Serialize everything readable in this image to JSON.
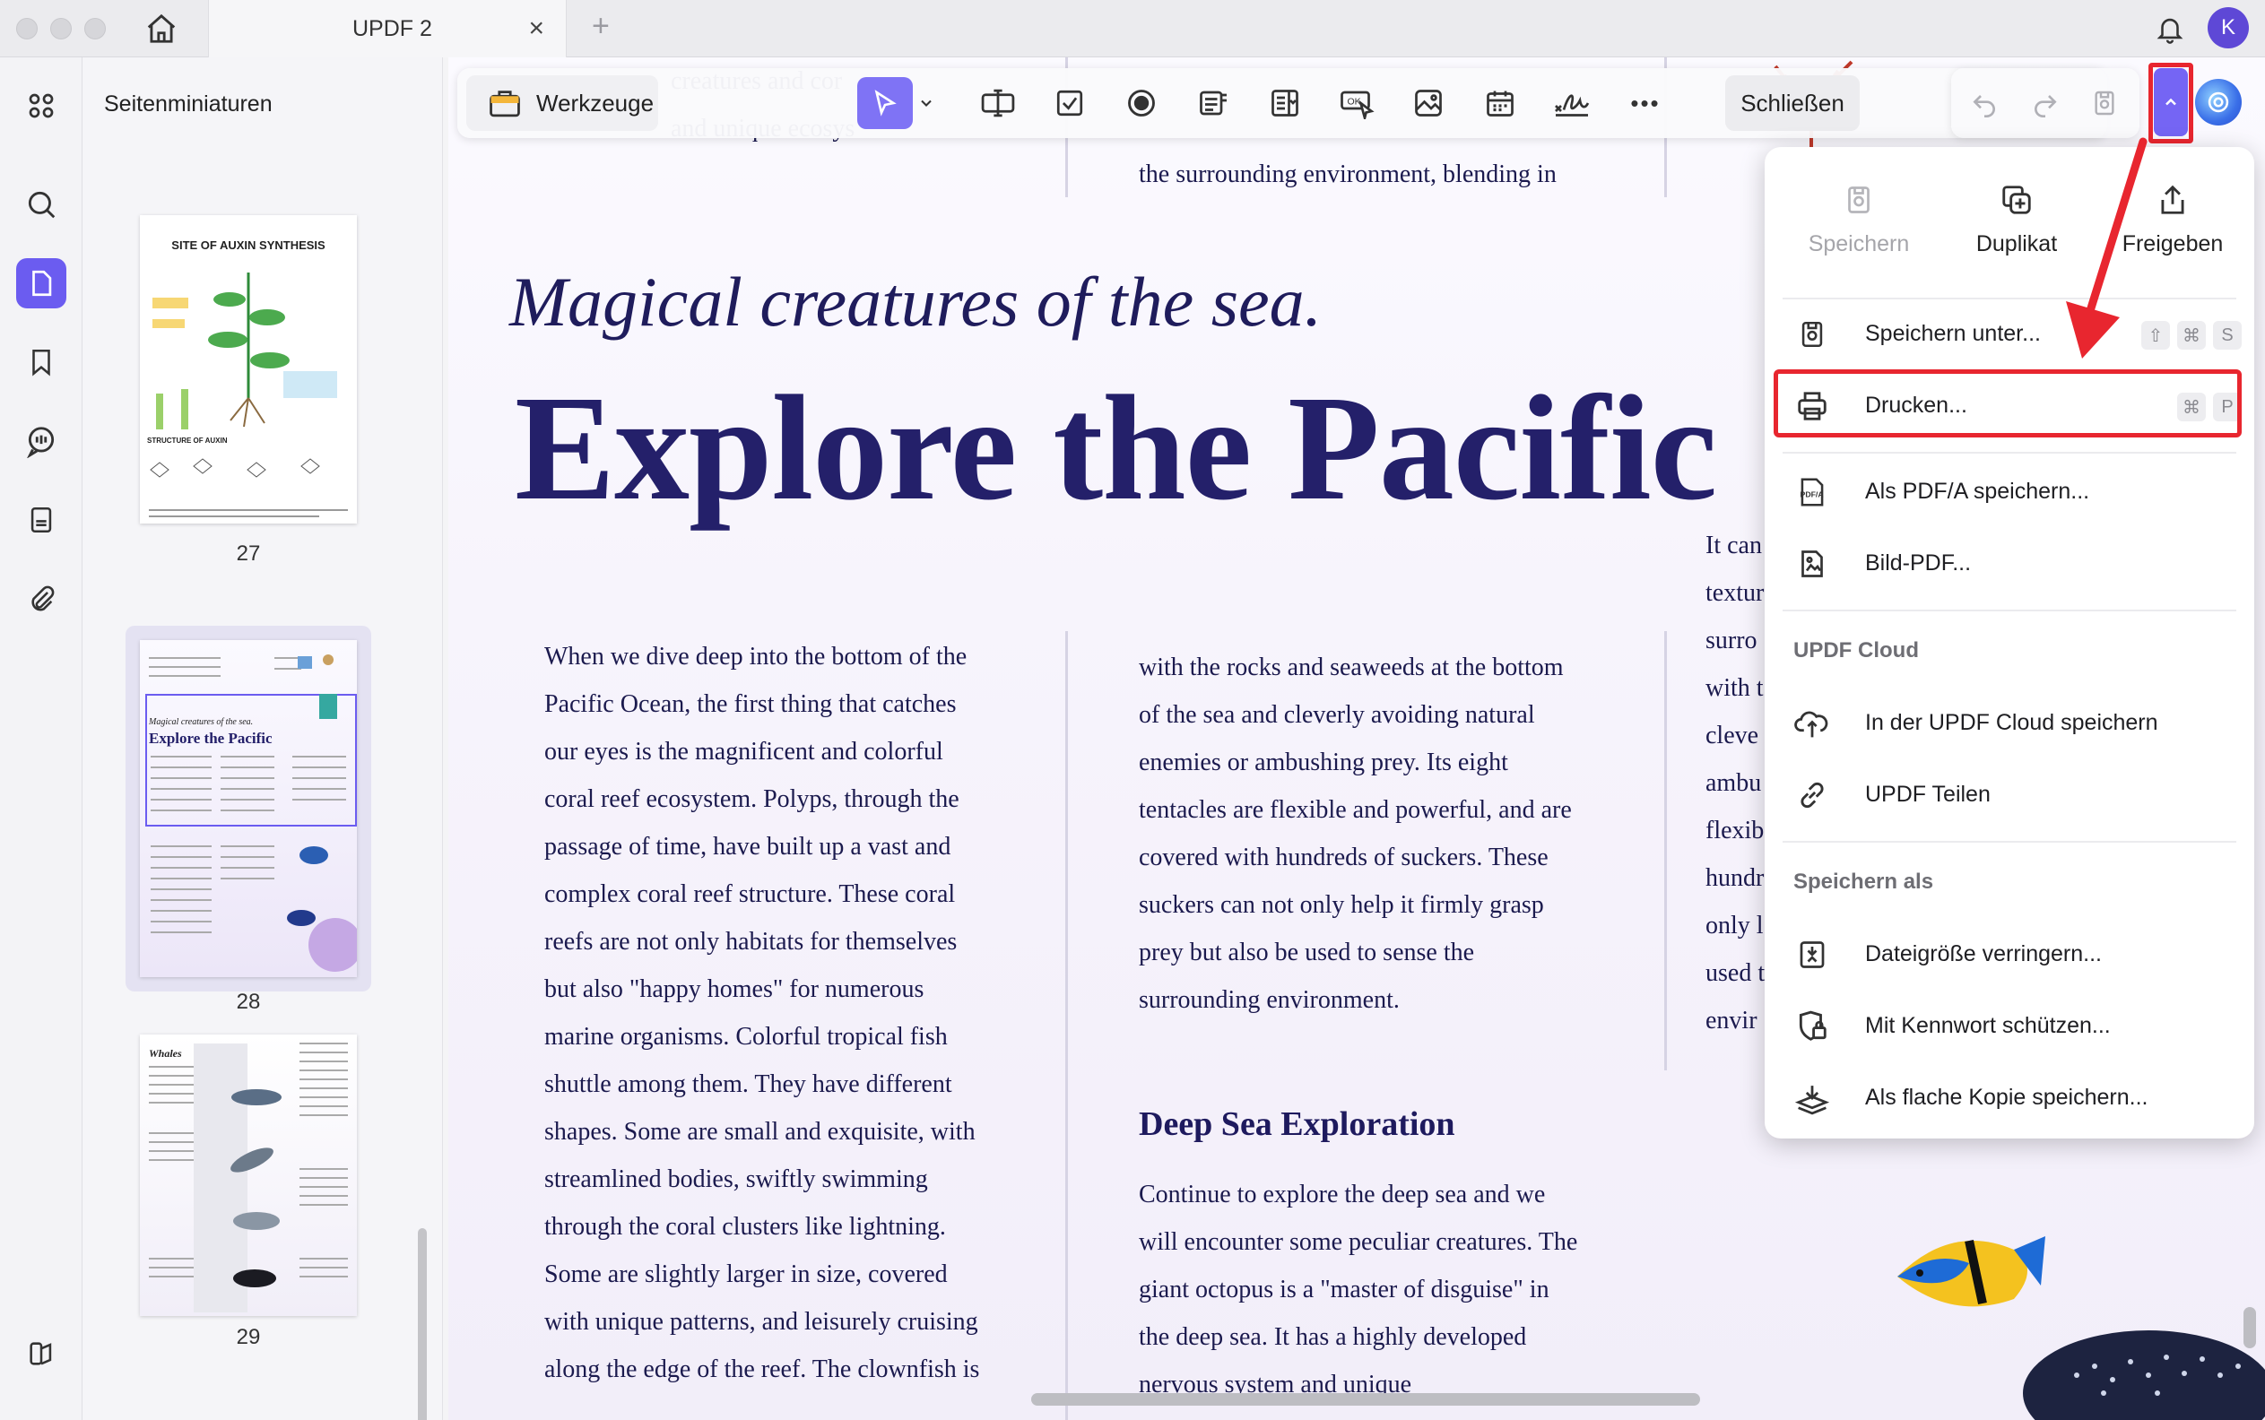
{
  "window": {
    "tab_title": "UPDF 2",
    "tab_close": "×",
    "new_tab": "+",
    "avatar_letter": "K"
  },
  "thumbnails": {
    "title": "Seitenminiaturen",
    "pages": [
      "27",
      "28",
      "29"
    ],
    "thumb27_title": "SITE OF AUXIN SYNTHESIS",
    "thumb27_structure": "STRUCTURE OF AUXIN",
    "thumb28_subtitle": "Magical creatures of the sea.",
    "thumb28_title": "Explore the Pacific",
    "thumb29_title": "Whales"
  },
  "toolbar": {
    "tools_label": "Werkzeuge",
    "more_label": "•••",
    "close_label": "Schließen"
  },
  "document": {
    "top_left_frag": [
      "creatures and cor",
      "and unique ecosys"
    ],
    "top_mid_frag": "the surrounding environment, blending in",
    "subtitle": "Magical creatures of the sea.",
    "headline": "Explore the Pacific",
    "col1": [
      "When we dive deep into the bottom of the",
      "Pacific Ocean, the first thing that catches",
      "our eyes is the magnificent and colorful",
      "coral reef ecosystem. Polyps, through the",
      "passage of time, have built up a vast and",
      "complex coral reef structure. These coral",
      "reefs are not only habitats for themselves",
      "but also \"happy homes\" for numerous",
      "marine organisms. Colorful tropical fish",
      "shuttle among them. They have different",
      "shapes. Some are small and exquisite, with",
      "streamlined bodies, swiftly swimming",
      "through the coral clusters like lightning.",
      "Some are slightly larger in size, covered",
      "with unique patterns, and leisurely cruising",
      "along the edge of the reef. The clownfish is"
    ],
    "col2": [
      "with the rocks and seaweeds at the bottom",
      "of the sea and cleverly avoiding natural",
      "enemies or ambushing prey. Its eight",
      "tentacles are flexible and powerful, and are",
      "covered with hundreds of suckers. These",
      "suckers can not only help it firmly grasp",
      "prey but also be used to sense the",
      "surrounding environment."
    ],
    "section_heading": "Deep Sea Exploration",
    "col2b": [
      "Continue to explore the deep sea and we",
      "will encounter some peculiar creatures. The",
      "giant octopus is a \"master of disguise\" in",
      "the deep sea. It has a highly developed",
      "nervous system and unique"
    ],
    "col3_frag": [
      "It can",
      "textur",
      "surro",
      "with t",
      "cleve",
      "ambu",
      "flexib",
      "hundr",
      "only l",
      "used t",
      "envir"
    ]
  },
  "menu": {
    "top_actions": [
      {
        "label": "Speichern",
        "disabled": true
      },
      {
        "label": "Duplikat",
        "disabled": false
      },
      {
        "label": "Freigeben",
        "disabled": false
      }
    ],
    "save_as": {
      "label": "Speichern unter...",
      "keys": [
        "⇧",
        "⌘",
        "S"
      ]
    },
    "print": {
      "label": "Drucken...",
      "keys": [
        "⌘",
        "P"
      ]
    },
    "pdfa": {
      "label": "Als PDF/A speichern..."
    },
    "image_pdf": {
      "label": "Bild-PDF..."
    },
    "cloud_section": "UPDF Cloud",
    "cloud_save": {
      "label": "In der UPDF Cloud speichern"
    },
    "share": {
      "label": "UPDF Teilen"
    },
    "save_as_section": "Speichern als",
    "reduce": {
      "label": "Dateigröße verringern..."
    },
    "protect": {
      "label": "Mit Kennwort schützen..."
    },
    "flatten": {
      "label": "Als flache Kopie speichern..."
    }
  },
  "colors": {
    "accent": "#6b5cf0",
    "highlight_red": "#e8262f",
    "heading_navy": "#24206a"
  }
}
